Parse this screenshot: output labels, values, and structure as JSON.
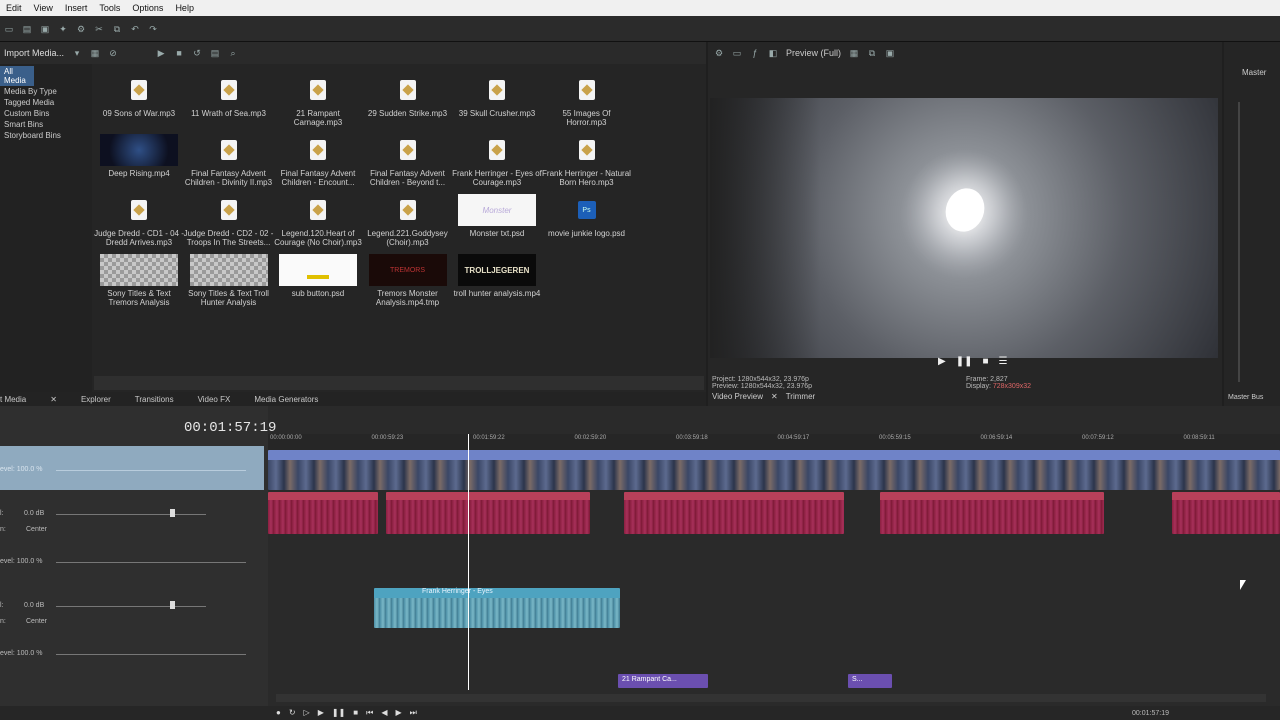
{
  "menubar": [
    "Edit",
    "View",
    "Insert",
    "Tools",
    "Options",
    "Help"
  ],
  "media_toolbar": {
    "import_label": "Import Media..."
  },
  "tree": [
    "All Media",
    "Media By Type",
    "Tagged Media",
    "Custom Bins",
    "Smart Bins",
    "Storyboard Bins"
  ],
  "media_items": [
    {
      "name": "09 Sons of War.mp3",
      "kind": "file"
    },
    {
      "name": "11 Wrath of Sea.mp3",
      "kind": "file"
    },
    {
      "name": "21 Rampant Carnage.mp3",
      "kind": "file"
    },
    {
      "name": "29 Sudden Strike.mp3",
      "kind": "file"
    },
    {
      "name": "39 Skull Crusher.mp3",
      "kind": "file"
    },
    {
      "name": "55 Images Of Horror.mp3",
      "kind": "file"
    },
    {
      "name": "Deep Rising.mp4",
      "kind": "video"
    },
    {
      "name": "Final Fantasy Advent Children - Divinity II.mp3",
      "kind": "file"
    },
    {
      "name": "Final Fantasy Advent Children - Encount...",
      "kind": "file"
    },
    {
      "name": "Final Fantasy Advent Children - Beyond t...",
      "kind": "file"
    },
    {
      "name": "Frank Herringer - Eyes of Courage.mp3",
      "kind": "file"
    },
    {
      "name": "Frank Herringer - Natural Born Hero.mp3",
      "kind": "file"
    },
    {
      "name": "Judge Dredd - CD1 - 04 - Dredd Arrives.mp3",
      "kind": "file"
    },
    {
      "name": "Judge Dredd - CD2 - 02 - Troops In The Streets...",
      "kind": "file"
    },
    {
      "name": "Legend.120.Heart of Courage (No Choir).mp3",
      "kind": "file"
    },
    {
      "name": "Legend.221.Goddysey (Choir).mp3",
      "kind": "file"
    },
    {
      "name": "Monster txt.psd",
      "kind": "monster"
    },
    {
      "name": "movie junkie logo.psd",
      "kind": "ps"
    },
    {
      "name": "Sony Titles & Text Tremors Analysis",
      "kind": "checker"
    },
    {
      "name": "Sony Titles & Text Troll Hunter Analysis",
      "kind": "checker"
    },
    {
      "name": "sub button.psd",
      "kind": "white"
    },
    {
      "name": "Tremors Monster Analysis.mp4.tmp",
      "kind": "red"
    },
    {
      "name": "troll hunter analysis.mp4",
      "kind": "troll"
    }
  ],
  "thumb_text": {
    "troll": "TROLLJEGEREN",
    "red": "TREMORS",
    "monster": "Monster",
    "ps": "Ps"
  },
  "lower_tabs": [
    "t Media",
    "Explorer",
    "Transitions",
    "Video FX",
    "Media Generators"
  ],
  "preview": {
    "mode": "Preview (Full)",
    "project": "Project:   1280x544x32, 23.976p",
    "preview_res": "Preview:  1280x544x32, 23.976p",
    "frame": "Frame:   2,827",
    "display_label": "Display:",
    "display_value": "728x309x32",
    "tabs": [
      "Video Preview",
      "Trimmer"
    ]
  },
  "master": {
    "title": "Master",
    "tab": "Master Bus"
  },
  "timeline": {
    "timecode": "00:01:57:19",
    "ruler": [
      "00:00:00:00",
      "00:00:59:23",
      "00:01:59:22",
      "00:02:59:20",
      "00:03:59:18",
      "00:04:59:17",
      "00:05:59:15",
      "00:06:59:14",
      "00:07:59:12",
      "00:08:59:11"
    ],
    "track1_level": "evel: 100.0 %",
    "track2_vol": "l:",
    "track2_vol_val": "0.0 dB",
    "track2_pan": "n:",
    "track2_pan_val": "Center",
    "track3_level": "evel: 100.0 %",
    "track4_vol": "l:",
    "track4_vol_val": "0.0 dB",
    "track4_pan": "n:",
    "track4_pan_val": "Center",
    "track5_level": "evel: 100.0 %",
    "teal_clip_title": "Frank Herringer - Eyes",
    "purple_clips": [
      "21 Rampant Ca...",
      "S..."
    ],
    "end_timecode": "00:01:57:19"
  },
  "colors": {
    "video_clip": "#6f83c8",
    "audio_red": "#a8305a",
    "audio_teal": "#4ea3c0",
    "title_purple": "#6b4fb0"
  }
}
